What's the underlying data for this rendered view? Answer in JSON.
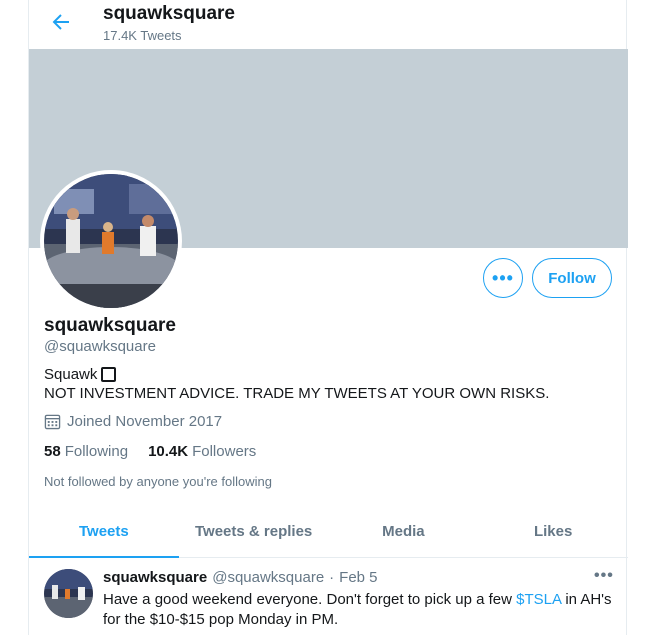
{
  "header": {
    "name": "squawksquare",
    "tweet_count": "17.4K Tweets",
    "back_icon": "arrow-left-icon"
  },
  "profile": {
    "name": "squawksquare",
    "handle": "@squawksquare",
    "bio_line1": "Squawk",
    "bio_line2": "NOT INVESTMENT ADVICE. TRADE MY TWEETS AT YOUR OWN RISKS.",
    "joined": "Joined November 2017",
    "following_count": "58",
    "following_label": "Following",
    "followers_count": "10.4K",
    "followers_label": "Followers",
    "not_followed": "Not followed by anyone you're following",
    "more_label": "•••",
    "follow_label": "Follow"
  },
  "tabs": [
    {
      "label": "Tweets",
      "active": true
    },
    {
      "label": "Tweets & replies",
      "active": false
    },
    {
      "label": "Media",
      "active": false
    },
    {
      "label": "Likes",
      "active": false
    }
  ],
  "tweet": {
    "name": "squawksquare",
    "handle": "@squawksquare",
    "separator": "·",
    "date": "Feb 5",
    "more_label": "•••",
    "text_before": "Have a good weekend everyone. Don't forget to pick up a few ",
    "cashtag": "$TSLA",
    "text_after": " in AH's for the $10-$15 pop Monday in PM."
  },
  "colors": {
    "accent": "#1da1f2",
    "banner": "#c4cfd6",
    "muted": "#657786"
  }
}
